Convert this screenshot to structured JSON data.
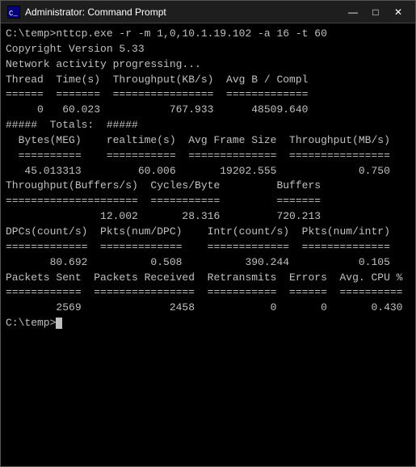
{
  "titlebar": {
    "title": "Administrator: Command Prompt"
  },
  "controls": {
    "minimize": "—",
    "maximize": "□",
    "close": "✕"
  },
  "terminal": {
    "lines": [
      "C:\\temp>nttcp.exe -r -m 1,0,10.1.19.102 -a 16 -t 60",
      "Copyright Version 5.33",
      "Network activity progressing...",
      "",
      "",
      "Thread  Time(s)  Throughput(KB/s)  Avg B / Compl",
      "======  =======  ================  =============",
      "     0   60.023           767.933      48509.640",
      "",
      "",
      "#####  Totals:  #####",
      "",
      "",
      "  Bytes(MEG)    realtime(s)  Avg Frame Size  Throughput(MB/s)",
      "  ==========    ===========  ==============  ================",
      "   45.013313         60.006       19202.555             0.750",
      "",
      "",
      "Throughput(Buffers/s)  Cycles/Byte         Buffers",
      "=====================  ===========         =======",
      "               12.002       28.316         720.213",
      "",
      "",
      "DPCs(count/s)  Pkts(num/DPC)    Intr(count/s)  Pkts(num/intr)",
      "=============  =============    =============  ==============",
      "       80.692          0.508          390.244           0.105",
      "",
      "",
      "Packets Sent  Packets Received  Retransmits  Errors  Avg. CPU %",
      "============  ================  ===========  ======  ==========",
      "        2569              2458            0       0       0.430",
      "",
      "C:\\temp>"
    ],
    "prompt": "C:\\temp>"
  }
}
